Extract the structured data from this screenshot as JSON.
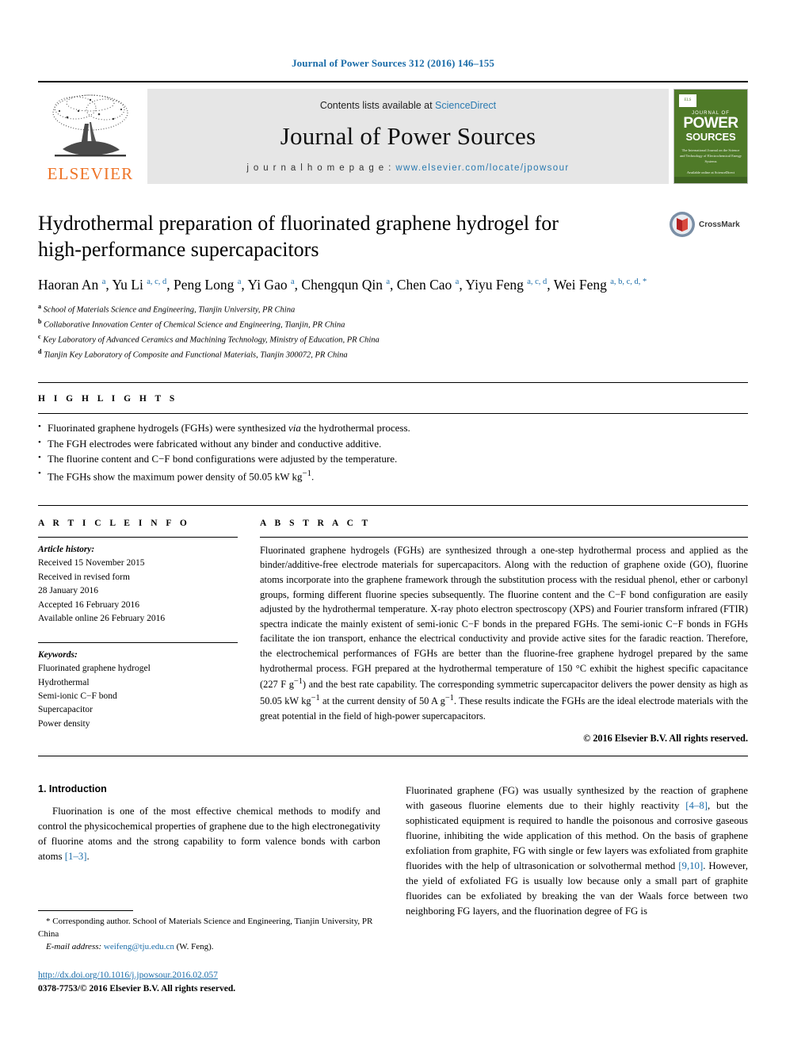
{
  "running_head": "Journal of Power Sources 312 (2016) 146–155",
  "masthead": {
    "contents_prefix": "Contents lists available at ",
    "contents_link": "ScienceDirect",
    "journal_title": "Journal of Power Sources",
    "homepage_label": "j o u r n a l   h o m e p a g e :  ",
    "homepage_url": "www.elsevier.com/locate/jpowsour",
    "publisher": "ELSEVIER",
    "cover": {
      "line1": "JOURNAL OF",
      "line2": "POWER",
      "line3": "SOURCES",
      "subtitle": "The International Journal on the Science and Technology of Electrochemical Energy Systems",
      "footer": "Available online at\nScienceDirect"
    }
  },
  "article": {
    "title": "Hydrothermal preparation of fluorinated graphene hydrogel for high-performance supercapacitors",
    "crossmark_label": "CrossMark",
    "authors_html": "Haoran An <sup>a</sup>, Yu Li <sup>a, c, d</sup>, Peng Long <sup>a</sup>, Yi Gao <sup>a</sup>, Chengqun Qin <sup>a</sup>, Chen Cao <sup>a</sup>, Yiyu Feng <sup>a, c, d</sup>, Wei Feng <sup>a, b, c, d, *</sup>",
    "affiliations": [
      {
        "mark": "a",
        "text": "School of Materials Science and Engineering, Tianjin University, PR China"
      },
      {
        "mark": "b",
        "text": "Collaborative Innovation Center of Chemical Science and Engineering, Tianjin, PR China"
      },
      {
        "mark": "c",
        "text": "Key Laboratory of Advanced Ceramics and Machining Technology, Ministry of Education, PR China"
      },
      {
        "mark": "d",
        "text": "Tianjin Key Laboratory of Composite and Functional Materials, Tianjin 300072, PR China"
      }
    ]
  },
  "highlights": {
    "heading": "H I G H L I G H T S",
    "items_html": [
      "Fluorinated graphene hydrogels (FGHs) were synthesized <em>via</em> the hydrothermal process.",
      "The FGH electrodes were fabricated without any binder and conductive additive.",
      "The fluorine content and C−F bond configurations were adjusted by the temperature.",
      "The FGHs show the maximum power density of 50.05 kW kg<sup>−1</sup>."
    ]
  },
  "article_info": {
    "heading": "A R T I C L E   I N F O",
    "history_label": "Article history:",
    "history_lines": [
      "Received 15 November 2015",
      "Received in revised form",
      "28 January 2016",
      "Accepted 16 February 2016",
      "Available online 26 February 2016"
    ],
    "keywords_label": "Keywords:",
    "keywords": [
      "Fluorinated graphene hydrogel",
      "Hydrothermal",
      "Semi-ionic C−F bond",
      "Supercapacitor",
      "Power density"
    ]
  },
  "abstract": {
    "heading": "A B S T R A C T",
    "text_html": "Fluorinated graphene hydrogels (FGHs) are synthesized through a one-step hydrothermal process and applied as the binder/additive-free electrode materials for supercapacitors. Along with the reduction of graphene oxide (GO), fluorine atoms incorporate into the graphene framework through the substitution process with the residual phenol, ether or carbonyl groups, forming different fluorine species subsequently. The fluorine content and the C−F bond configuration are easily adjusted by the hydrothermal temperature. X-ray photo electron spectroscopy (XPS) and Fourier transform infrared (FTIR) spectra indicate the mainly existent of semi-ionic C−F bonds in the prepared FGHs. The semi-ionic C−F bonds in FGHs facilitate the ion transport, enhance the electrical conductivity and provide active sites for the faradic reaction. Therefore, the electrochemical performances of FGHs are better than the fluorine-free graphene hydrogel prepared by the same hydrothermal process. FGH prepared at the hydrothermal temperature of 150 °C exhibit the highest specific capacitance (227 F g<sup>−1</sup>) and the best rate capability. The corresponding symmetric supercapacitor delivers the power density as high as 50.05 kW kg<sup>−1</sup> at the current density of 50 A g<sup>−1</sup>. These results indicate the FGHs are the ideal electrode materials with the great potential in the field of high-power supercapacitors.",
    "copyright": "© 2016 Elsevier B.V. All rights reserved."
  },
  "introduction": {
    "heading": "1.  Introduction",
    "left_paragraph_html": "Fluorination is one of the most effective chemical methods to modify and control the physicochemical properties of graphene due to the high electronegativity of fluorine atoms and the strong capability to form valence bonds with carbon atoms <span class=\"ref\">[1–3]</span>.",
    "right_paragraph_html": "Fluorinated graphene (FG) was usually synthesized by the reaction of graphene with gaseous fluorine elements due to their highly reactivity <span class=\"ref\">[4–8]</span>, but the sophisticated equipment is required to handle the poisonous and corrosive gaseous fluorine, inhibiting the wide application of this method. On the basis of graphene exfoliation from graphite, FG with single or few layers was exfoliated from graphite fluorides with the help of ultrasonication or solvothermal method <span class=\"ref\">[9,10]</span>. However, the yield of exfoliated FG is usually low because only a small part of graphite fluorides can be exfoliated by breaking the van der Waals force between two neighboring FG layers, and the fluorination degree of FG is"
  },
  "footer": {
    "corresponding_html": "* Corresponding author. School of Materials Science and Engineering, Tianjin University, PR China",
    "email_label": "E-mail address:",
    "email": "weifeng@tju.edu.cn",
    "email_suffix": "(W. Feng).",
    "doi": "http://dx.doi.org/10.1016/j.jpowsour.2016.02.057",
    "issn_line": "0378-7753/© 2016 Elsevier B.V. All rights reserved."
  },
  "colors": {
    "link": "#1b6ca8",
    "elsevier_orange": "#EE7326",
    "cover_green": "#4f7a28",
    "band_gray": "#e6e6e6"
  }
}
